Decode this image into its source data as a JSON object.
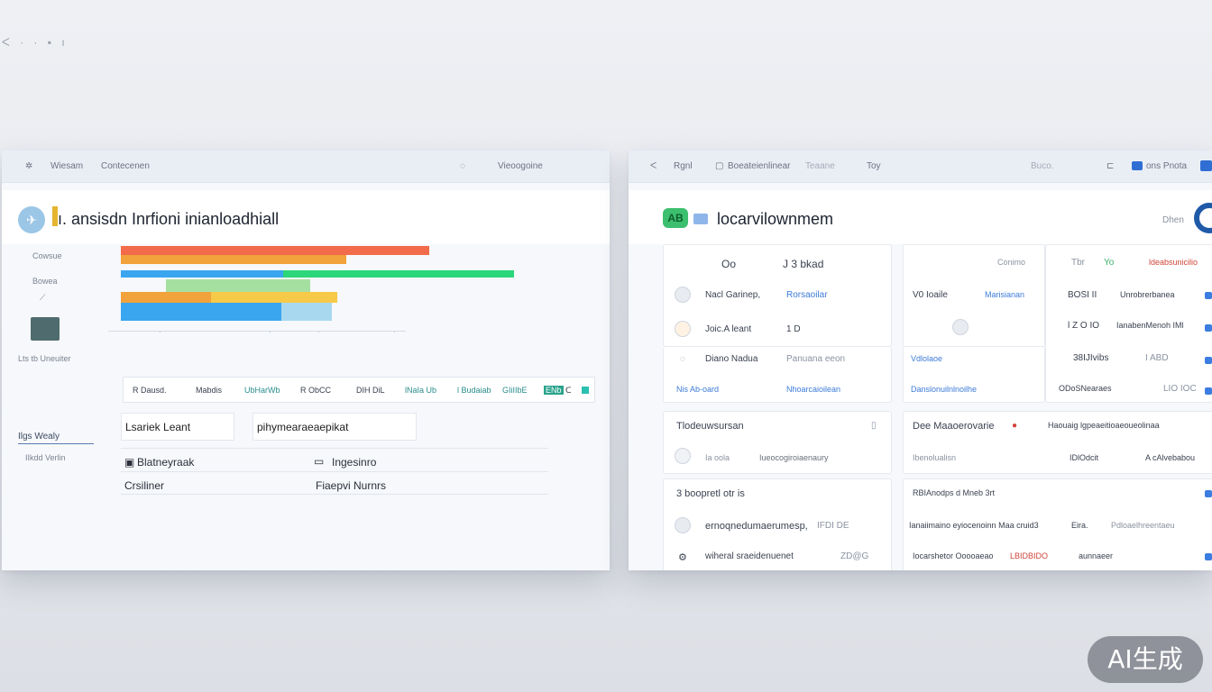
{
  "corner_marks": "ᐸ · · ▪ ı",
  "left_window": {
    "topbar": {
      "item1": "Wiesam",
      "item2": "Contecenen",
      "item3": "Vieoogoine"
    },
    "title": "ı. ansisdn Inrfioni  inianloadhiall",
    "sidebar": {
      "item1": "Cowsue",
      "item2": "Bowea",
      "item3": "Lts  tb Uneuiter",
      "selected": "Ilgs Wealy",
      "item4": "IIkdd Verlin"
    },
    "chart_data": {
      "type": "bar",
      "colors": [
        "#f26b4a",
        "#f1a23b",
        "#2cd67a",
        "#3aa6f0",
        "#f7c948",
        "#a6e0a0"
      ]
    },
    "tags": [
      "R Dausd.",
      "Mabdis",
      "UbHarWb",
      "R ObCC",
      "DIH DiL",
      "lNaIa Ub",
      "l Budaiab",
      "GIiIIbE",
      "ENb"
    ],
    "fields": {
      "field1": "Lsariek Leant",
      "field2": "pihymearaeaepikat"
    },
    "rows": {
      "r1a": "Blatneyraak",
      "r1b": "Ingesinro",
      "r2a": "Crsiliner",
      "r2b": "Fiaepvi Nurnrs"
    }
  },
  "right_window": {
    "topbar": {
      "item1": "Rgnl",
      "item2": "Boeateienlinear",
      "item3": "Teaane",
      "item4": "Toy",
      "item5": "Buco.",
      "item6": "ons Pnota"
    },
    "title": "locarvilownmem",
    "header_right": "Dhen",
    "logo_text": "AB",
    "card1": {
      "col_a": "Oo",
      "col_b": "J 3 bkad",
      "r1a": "Nacl Garinep,",
      "r1b": "Rorsaoilar",
      "r2a": "Joic.A leant",
      "r2b": "1 D",
      "r3a": "Diano Nadua",
      "r3b": "Panuana eeon",
      "r4a": "Nis Ab-oard",
      "r4b": "Nhoarcaioilean"
    },
    "card2": {
      "head": "Conimo",
      "r1a": "V0  Ioaile",
      "r1b": "Marisianan",
      "r2a": "Vdlolaoe",
      "r2b": "Danslonuilnlnoilhe"
    },
    "card3": {
      "head1": "Tbr",
      "head2": "Yo",
      "head3": "ldeabsunicilio",
      "r1a": "BOSI II",
      "r1b": "Unrobrerbanea",
      "r2a": "l Z O IO",
      "r2b": "IanabenMenoh IMl",
      "r3a": "38IJIvibs",
      "r3b": "I ABD",
      "r4a": "ODoSNearaes",
      "r4b": "LIO IOC"
    },
    "card4": {
      "head": "Tlodeuwsursan",
      "r1a": "Ia oola",
      "r1b": "Iueocogiroiaenaury"
    },
    "card5": {
      "head": "Dee  Maaoerovarie",
      "head2": "Haouaig lgpeaeitioaeoueolinaa",
      "r1a": "Ibenolualisn",
      "r1b": "IDlOdcit",
      "r1c": "A cAlvebabou"
    },
    "card6": {
      "head": "3 boopretl otr is",
      "r1": "ernoqnedumaerumesp,",
      "r1b": "IFDI DE",
      "r2": "wiheral  sraeidenuenet",
      "r2b": "ZD@G"
    },
    "card7": {
      "head": "RBIAnodps d  Mneb  3rt",
      "r1": "Ianaiimaino eyiocenoinn  Maa cruid3",
      "r1b": "Eira.",
      "r1c": "Pdloaelhreentaeu",
      "r2": "Iocarshetor Ooooaeao",
      "r2b": "LBIDBIDO",
      "r2c": "aunnaeer"
    }
  },
  "badge": "AI生成"
}
